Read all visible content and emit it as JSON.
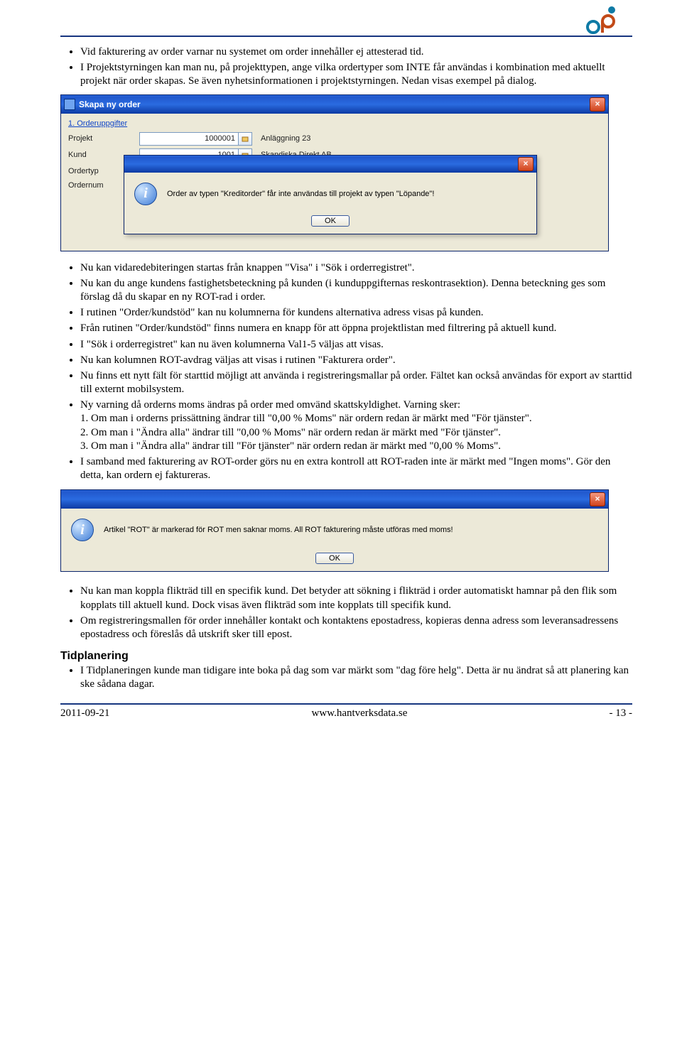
{
  "top_bullets": [
    "Vid fakturering av order varnar nu systemet om order innehåller ej attesterad tid.",
    "I Projektstyrningen kan man nu, på projekttypen, ange vilka ordertyper som INTE får användas i kombination med aktuellt projekt när order skapas. Se även nyhetsinformationen i projektstyrningen. Nedan visas exempel på dialog."
  ],
  "dialog1": {
    "title": "Skapa ny order",
    "section": "1. Orderuppgifter",
    "rows": [
      {
        "label": "Projekt",
        "value": "1000001",
        "desc": "Anläggning 23"
      },
      {
        "label": "Kund",
        "value": "1001",
        "desc": "Skandiska Direkt AB"
      },
      {
        "label": "Ordertyp",
        "value": "",
        "desc": ""
      },
      {
        "label": "Ordernum",
        "value": "",
        "desc": ""
      }
    ],
    "msg": "Order av typen \"Kreditorder\" får inte användas till projekt av typen \"Löpande\"!",
    "ok": "OK"
  },
  "mid_bullets": [
    "Nu kan vidaredebiteringen startas från knappen \"Visa\" i \"Sök i orderregistret\".",
    "Nu kan du ange kundens fastighetsbeteckning på kunden (i kunduppgifternas reskontrasektion). Denna beteckning ges som förslag då du skapar en ny ROT-rad i order.",
    "I rutinen \"Order/kundstöd\" kan nu kolumnerna för kundens alternativa adress visas på kunden.",
    "Från rutinen \"Order/kundstöd\" finns numera en knapp för att öppna projektlistan med filtrering på aktuell kund.",
    "I \"Sök i orderregistret\" kan nu även kolumnerna Val1-5 väljas att visas.",
    "Nu kan kolumnen ROT-avdrag väljas att visas i rutinen \"Fakturera order\".",
    "Nu finns ett nytt fält för starttid möjligt att använda i registreringsmallar på order. Fältet kan också användas för export av starttid till externt mobilsystem.",
    "Ny varning då orderns moms ändras på order med omvänd skattskyldighet. Varning sker:\n1. Om man i orderns prissättning ändrar till \"0,00 % Moms\" när ordern redan är märkt med \"För tjänster\".\n2. Om man i \"Ändra alla\" ändrar till \"0,00 % Moms\" när ordern redan är märkt med \"För tjänster\".\n3. Om man i \"Ändra alla\" ändrar till \"För tjänster\" när ordern redan är märkt med \"0,00 % Moms\".",
    "I samband med fakturering av ROT-order görs nu en extra kontroll att ROT-raden inte är märkt med \"Ingen moms\". Gör den detta, kan ordern ej faktureras."
  ],
  "dialog2": {
    "msg": "Artikel \"ROT\" är markerad för ROT men saknar moms. All ROT fakturering måste utföras med moms!",
    "ok": "OK"
  },
  "bottom_bullets": [
    "Nu kan man koppla flikträd till en specifik kund. Det betyder att sökning i flikträd i order automatiskt hamnar på den flik som kopplats till aktuell kund. Dock visas även flikträd som inte kopplats till specifik kund.",
    "Om registreringsmallen för order innehåller kontakt och kontaktens epostadress, kopieras denna adress som leveransadressens epostadress och föreslås då utskrift sker till epost."
  ],
  "section_heading": "Tidplanering",
  "tid_bullets": [
    "I Tidplaneringen kunde man tidigare inte boka på dag som var märkt som \"dag före helg\". Detta är nu ändrat så att planering kan ske sådana dagar."
  ],
  "footer": {
    "date": "2011-09-21",
    "url": "www.hantverksdata.se",
    "page": "- 13 -"
  }
}
